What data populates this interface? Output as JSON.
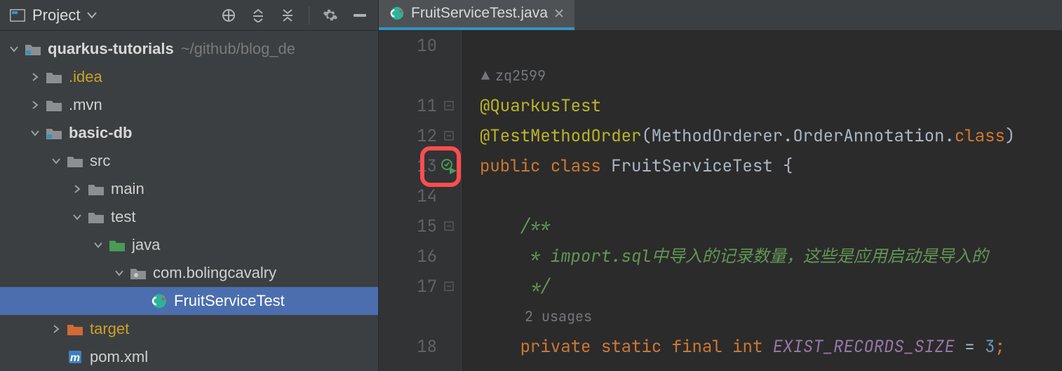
{
  "panel": {
    "title": "Project"
  },
  "tree": {
    "root_name": "quarkus-tutorials",
    "root_path": "~/github/blog_de",
    "idea": ".idea",
    "mvn": ".mvn",
    "basic_db": "basic-db",
    "src": "src",
    "main": "main",
    "test": "test",
    "java": "java",
    "pkg": "com.bolingcavalry",
    "cls": "FruitServiceTest",
    "target": "target",
    "pom": "pom.xml"
  },
  "tab": {
    "name": "FruitServiceTest.java"
  },
  "gutter": {
    "l10": "10",
    "l11": "11",
    "l12": "12",
    "l13": "13",
    "l14": "14",
    "l15": "15",
    "l16": "16",
    "l17": "17",
    "l18": "18"
  },
  "code": {
    "author": "zq2599",
    "ann1": "@QuarkusTest",
    "ann2_a": "@TestMethodOrder",
    "ann2_b": "(MethodOrderer.OrderAnnotation.",
    "ann2_c": "class",
    "ann2_d": ")",
    "decl_public": "public",
    "decl_class": "class",
    "decl_name": "FruitServiceTest",
    "decl_brace": "{",
    "doc_open": "/**",
    "doc_mid": " * import.sql中导入的记录数量，这些是应用启动是导入的",
    "doc_close": " */",
    "usages": "2 usages",
    "f_private": "private",
    "f_static": "static",
    "f_final": "final",
    "f_int": "int",
    "f_name": "EXIST_RECORDS_SIZE",
    "f_eq": " = ",
    "f_val": "3",
    "f_semi": ";"
  }
}
